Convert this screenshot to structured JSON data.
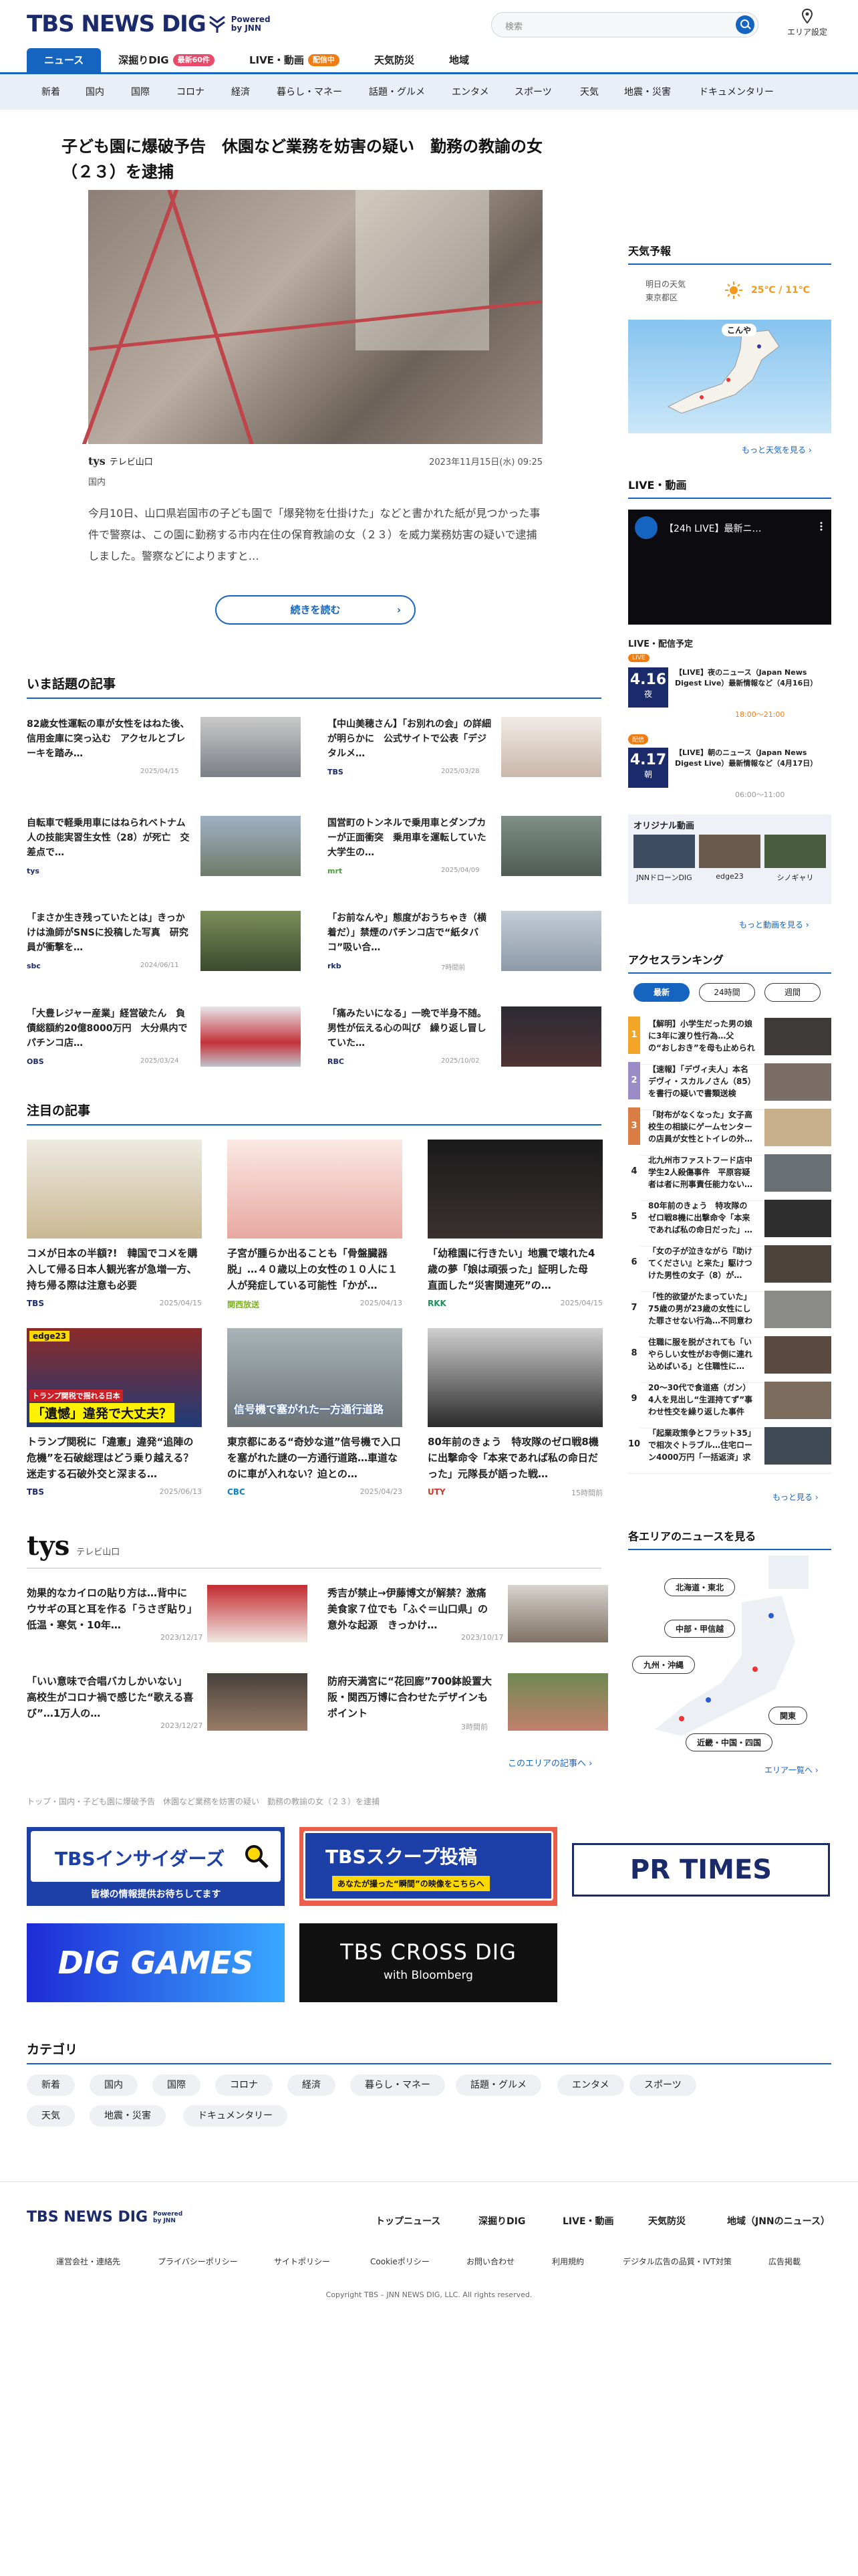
{
  "header": {
    "logo": "TBS NEWS DIG",
    "powered": "Powered",
    "by": "by JNN",
    "search_placeholder": "検索",
    "area_label": "エリア設定"
  },
  "gnav": [
    {
      "label": "ニュース",
      "on": true
    },
    {
      "label": "深掘りDIG",
      "badge": "最新60件"
    },
    {
      "label": "LIVE・動画",
      "badge": "配信中"
    },
    {
      "label": "天気防災"
    },
    {
      "label": "地域"
    }
  ],
  "categories": [
    "新着",
    "国内",
    "国際",
    "コロナ",
    "経済",
    "暮らし・マネー",
    "話題・グルメ",
    "エンタメ",
    "スポーツ",
    "天気",
    "地震・災害",
    "ドキュメンタリー"
  ],
  "article": {
    "title": "子ども園に爆破予告　休園など業務を妨害の疑い　勤務の教諭の女（２３）を逮捕",
    "source": "テレビ山口",
    "source_logo": "tys",
    "time": "2023年11月15日(水) 09:25",
    "category": "国内",
    "lead": "今月10日、山口県岩国市の子ども園で「爆発物を仕掛けた」などと書かれた紙が見つかった事件で警察は、この園に勤務する市内在住の保育教諭の女（２３）を威力業務妨害の疑いで逮捕しました。警察などによりますと…",
    "more": "続きを読む"
  },
  "topics": {
    "heading": "いま話題の記事",
    "items": [
      {
        "text": "82歳女性運転の車が女性をはねた後、信用金庫に突っ込む　アクセルとブレーキを踏み…",
        "src": "",
        "date": "2025/04/15"
      },
      {
        "text": "【中山美穂さん】「お別れの会」の詳細が明らかに　公式サイトで公表「デジタルメ…",
        "src": "TBS",
        "date": "2025/03/28"
      },
      {
        "text": "自転車で軽乗用車にはねられベトナム人の技能実習生女性（28）が死亡　交差点で…",
        "src": "tys",
        "date": ""
      },
      {
        "text": "国営町のトンネルで乗用車とダンプカーが正面衝突　乗用車を運転していた大学生の…",
        "src": "mrt",
        "date": "2025/04/09"
      },
      {
        "text": "「まさか生き残っていたとは」きっかけは漁師がSNSに投稿した写真　研究員が衝撃を…",
        "src": "sbc",
        "date": "2024/06/11"
      },
      {
        "text": "「お前なんや」態度がおうちゃき（横着だ）」禁煙のパチンコ店で“紙タバコ”吸い合…",
        "src": "rkb",
        "date": "7時間前"
      },
      {
        "text": "「大豊レジャー産業」経営破たん　負債総額約20億8000万円　大分県内でパチンコ店…",
        "src": "OBS",
        "date": "2025/03/24"
      },
      {
        "text": "「痛みたいになる」一晩で半身不随。男性が伝える心の叫び　繰り返し冒していた…",
        "src": "RBC",
        "date": "2025/10/02"
      }
    ]
  },
  "featured": {
    "heading": "注目の記事",
    "items": [
      {
        "text": "コメが日本の半額?!　韓国でコメを購入して帰る日本人観光客が急増一方、持ち帰る際は注意も必要",
        "src": "TBS",
        "date": "2025/04/15"
      },
      {
        "text": "子宮が腫らか出ることも「骨盤臓器脱」…４０歳以上の女性の１０人に１人が発症している可能性「かが…",
        "src": "関西放送",
        "date": "2025/04/13"
      },
      {
        "text": "「幼稚園に行きたい」地震で壊れた4歳の夢「娘は頑張った」証明した母　直面した“災害関連死”の…",
        "src": "RKK",
        "date": "2025/04/15"
      },
      {
        "text": "トランプ関税に「違憲」違発“追陣の危機”を石破総理はどう乗り越える？　迷走する石破外交と深まる…",
        "src": "TBS",
        "date": "2025/06/13"
      },
      {
        "text": "東京都にある“奇妙な道”信号機で入口を塞がれた謎の一方通行道路…車道なのに車が入れない？迫との…",
        "src": "CBC",
        "date": "2025/04/23"
      },
      {
        "text": "80年前のきょう　特攻隊のゼロ戦8機に出撃命令「本来であれば私の命日だった」元隊長が語った戦…",
        "src": "UTY",
        "date": "15時間前"
      }
    ],
    "banner_text": "「遺憾」違発で大丈夫？",
    "banner_sub": "トランプ関税で揺れる日本",
    "banner_tag": "edge23",
    "road_text": "信号機で塞がれた一方通行道路"
  },
  "tys_section": {
    "logo": "tys",
    "name": "テレビ山口",
    "items": [
      {
        "text": "効果的なカイロの貼り方は…背中にウサギの耳と耳を作る「うさぎ貼り」　低温・寒気・10年…",
        "date": "2023/12/17"
      },
      {
        "text": "秀吉が禁止→伊藤博文が解禁？激痛美食家７位でも「ふぐ＝山口県」の意外な起源　きっかけ…",
        "date": "2023/10/17"
      },
      {
        "text": "「いい意味で合唱バカしかいない」高校生がコロナ禍で感じた“歌える喜び”…1万人の…",
        "date": "2023/12/27"
      },
      {
        "text": "防府天満宮に“花回廊”700鉢設置大阪・関西万博に合わせたデザインもポイント",
        "date": "3時間前"
      }
    ],
    "more": "このエリアの記事へ"
  },
  "breadcrumb": "トップ・国内・子ども園に爆破予告　休園など業務を妨害の疑い　勤務の教諭の女（２３）を逮捕",
  "banners": {
    "insiders": "TBSインサイダーズ",
    "insiders_sub": "皆様の情報提供お待ちしてます",
    "scoop": "TBSスクープ投稿",
    "scoop_sub": "あなたが撮った“瞬間”の映像をこちらへ",
    "prtimes": "PR TIMES",
    "games": "DIG GAMES",
    "crossdig": "TBS CROSS DIG",
    "crossdig_sub": "with Bloomberg"
  },
  "category_section": {
    "heading": "カテゴリ",
    "items": [
      "新着",
      "国内",
      "国際",
      "コロナ",
      "経済",
      "暮らし・マネー",
      "話題・グルメ",
      "エンタメ",
      "スポーツ",
      "天気",
      "地震・災害",
      "ドキュメンタリー"
    ]
  },
  "sidebar": {
    "weather": {
      "heading": "天気予報",
      "label1": "明日の天気",
      "label2": "東京都区",
      "temp": "25℃ / 11℃",
      "map_label": "こんや",
      "more": "もっと天気を見る"
    },
    "live": {
      "heading": "LIVE・動画",
      "video_title": "【24h LIVE】最新ニ…",
      "schedule": "LIVE・配信予定",
      "events": [
        {
          "tag": "LIVE",
          "date": "4.16",
          "day": "夜",
          "title": "【LIVE】夜のニュース（Japan News Digest Live）最新情報など（4月16日）",
          "time": "18:00～21:00"
        },
        {
          "tag": "配信",
          "date": "4.17",
          "day": "朝",
          "title": "【LIVE】朝のニュース（Japan News Digest Live）最新情報など（4月17日）",
          "time": "06:00～11:00"
        }
      ],
      "orig": "オリジナル動画",
      "orig_items": [
        "JNNドローンDIG",
        "edge23",
        "シノギャリ"
      ],
      "more": "もっと動画を見る"
    },
    "ranking": {
      "heading": "アクセスランキング",
      "tabs": [
        "最新",
        "24時間",
        "週間"
      ],
      "items": [
        {
          "n": "1",
          "text": "【解明】小学生だった男の娘に3年に渡り性行為…父の“おしおき”を母も止められず…"
        },
        {
          "n": "2",
          "text": "【速報】「デヴィ夫人」本名デヴィ・スカルノさん（85）を書行の疑いで書類送検　女…"
        },
        {
          "n": "3",
          "text": "「財布がなくなった」女子高校生の相談にゲームセンターの店員が女性とトイレの外…"
        },
        {
          "n": "4",
          "text": "北九州市ファストフード店中学生2人殺傷事件　平原容疑者は者に刑事責任能力ない…"
        },
        {
          "n": "5",
          "text": "80年前のきょう　特攻隊のゼロ戦8機に出撃命令「本来であれば私の命日だった」…"
        },
        {
          "n": "6",
          "text": "「女の子が泣きながら『助けてください』と来た」駆けつけた男性の女子（8）が…"
        },
        {
          "n": "7",
          "text": "「性的欲望がたまっていた」75歳の男が23歳の女性にした罪させない行為…不同意わい…"
        },
        {
          "n": "8",
          "text": "住職に服を脱がされても「いやらしい女性がお寺側に連れ込めばいる」と住職性に…"
        },
        {
          "n": "9",
          "text": "20～30代で食道癌（ガン）4人を見出し“生涯持てず”事わせ性交を繰り返した事件　ペット…"
        },
        {
          "n": "10",
          "text": "「起業政策争とフラット35」で相次ぐトラブル…住宅ローン4000万円「一括返済」求め…"
        }
      ],
      "more": "もっと見る"
    },
    "regions": {
      "heading": "各エリアのニュースを見る",
      "items": [
        "北海道・東北",
        "中部・甲信越",
        "九州・沖縄",
        "関東",
        "近畿・中国・四国"
      ],
      "more": "エリア一覧へ"
    }
  },
  "footer": {
    "links": [
      "トップニュース",
      "深掘りDIG",
      "LIVE・動画",
      "天気防災",
      "地域（JNNのニュース）"
    ],
    "sub": [
      "運営会社・連絡先",
      "プライバシーポリシー",
      "サイトポリシー",
      "Cookieポリシー",
      "お問い合わせ",
      "利用規約",
      "デジタル広告の品質・IVT対策",
      "広告掲載"
    ],
    "copyright": "Copyright TBS – JNN NEWS DIG, LLC. All rights reserved."
  },
  "colors": {
    "brand": "#1b2a6b",
    "accent": "#1565c0",
    "live": "#e84a6a"
  }
}
